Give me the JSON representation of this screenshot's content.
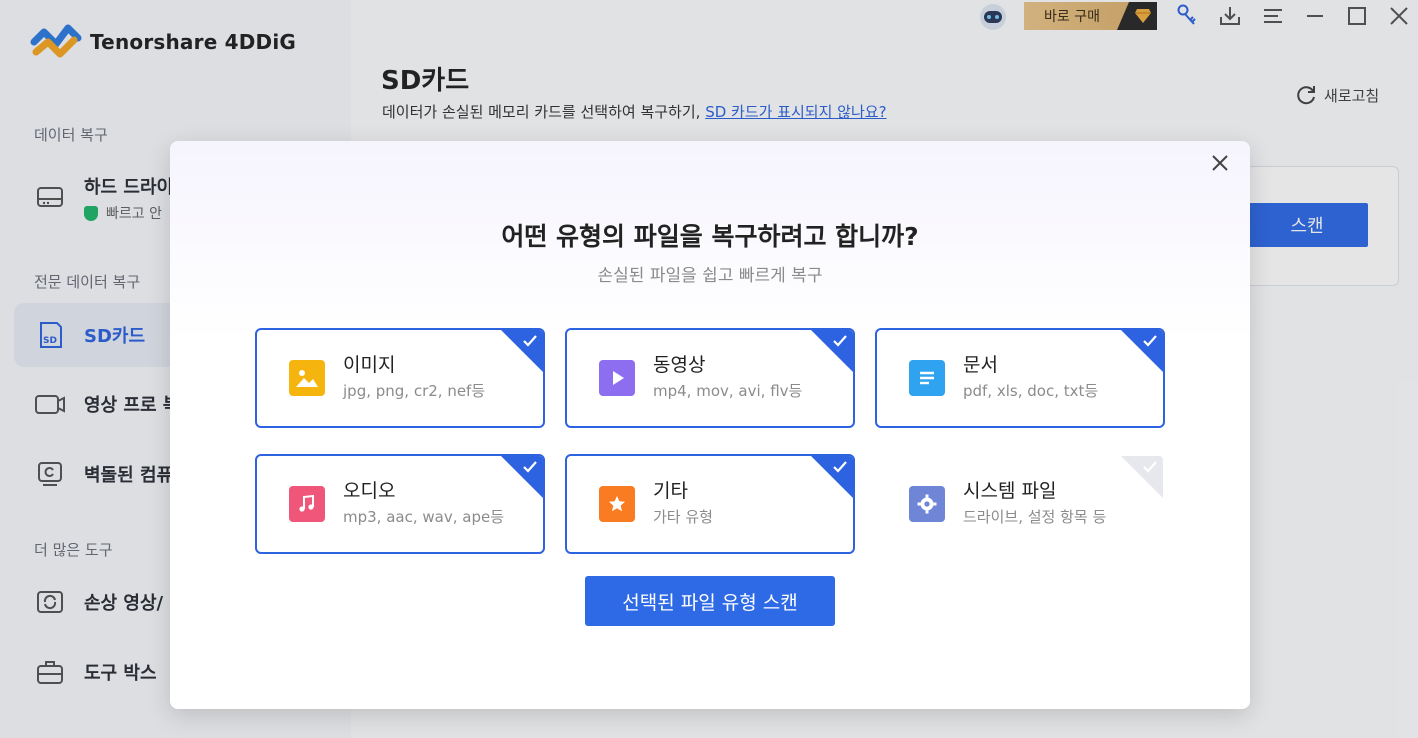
{
  "app": {
    "name": "Tenorshare 4DDiG"
  },
  "topbar": {
    "buy_label": "바로 구매"
  },
  "sidebar": {
    "section_recovery": "데이터 복구",
    "hard_drive": {
      "label": "하드 드라이",
      "sub": "빠르고 안"
    },
    "section_pro": "전문 데이터 복구",
    "sd_card": "SD카드",
    "video_pro": "영상 프로 복",
    "crashed_pc": "벽돌된 컴퓨",
    "section_more": "더 많은 도구",
    "damaged_video": "손상 영상/",
    "toolbox": "도구 박스"
  },
  "main": {
    "title": "SD카드",
    "desc": "데이터가 손실된 메모리 카드를 선택하여 복구하기, ",
    "desc_link": "SD 카드가 표시되지 않나요?",
    "refresh": "새로고침",
    "scan_bg": "스캔"
  },
  "modal": {
    "title": "어떤 유형의 파일을 복구하려고 합니까?",
    "subtitle": "손실된 파일을 쉽고 빠르게 복구",
    "types": [
      {
        "name": "이미지",
        "ext": "jpg, png, cr2, nef등",
        "checked": true,
        "color": "#f6b40f",
        "icon": "image-icon"
      },
      {
        "name": "동영상",
        "ext": "mp4, mov, avi, flv등",
        "checked": true,
        "color": "#8e6ef0",
        "icon": "video-icon"
      },
      {
        "name": "문서",
        "ext": "pdf, xls, doc, txt등",
        "checked": true,
        "color": "#2fa3f0",
        "icon": "document-icon"
      },
      {
        "name": "오디오",
        "ext": "mp3, aac, wav, ape등",
        "checked": true,
        "color": "#f0557a",
        "icon": "audio-icon"
      },
      {
        "name": "기타",
        "ext": "가타 유형",
        "checked": true,
        "color": "#f97c22",
        "icon": "star-icon"
      },
      {
        "name": "시스템 파일",
        "ext": "드라이브, 설정 항목 등",
        "checked": false,
        "color": "#6f86d6",
        "icon": "gear-icon"
      }
    ],
    "scan_button": "선택된 파일 유형 스캔"
  }
}
